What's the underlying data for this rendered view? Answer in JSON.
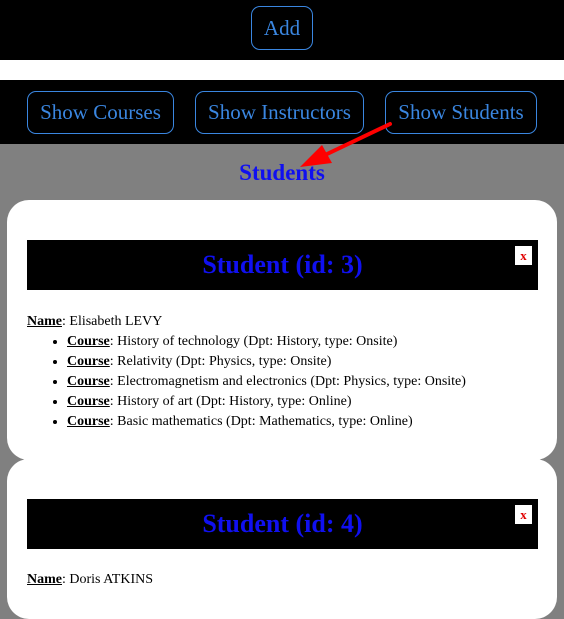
{
  "header": {
    "add_label": "Add"
  },
  "nav": {
    "courses_label": "Show Courses",
    "instructors_label": "Show Instructors",
    "students_label": "Show Students"
  },
  "main": {
    "title": "Students",
    "close_label": "x",
    "name_label": "Name",
    "course_label": "Course",
    "students": [
      {
        "heading": "Student (id: 3)",
        "name": "Elisabeth LEVY",
        "courses": [
          "History of technology (Dpt: History, type: Onsite)",
          "Relativity (Dpt: Physics, type: Onsite)",
          "Electromagnetism and electronics (Dpt: Physics, type: Onsite)",
          "History of art (Dpt: History, type: Online)",
          "Basic mathematics (Dpt: Mathematics, type: Online)"
        ]
      },
      {
        "heading": "Student (id: 4)",
        "name": "Doris ATKINS",
        "courses": []
      }
    ]
  },
  "colors": {
    "accent_blue": "#3a86e0",
    "heading_blue": "#1010f0",
    "close_red": "#e00000",
    "arrow_red": "#ff0000",
    "background_gray": "#808080"
  }
}
